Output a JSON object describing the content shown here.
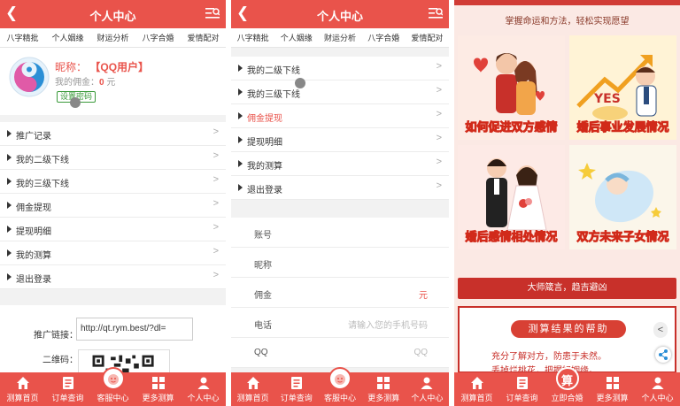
{
  "screen1": {
    "header": {
      "back_icon": "chevron-left-icon",
      "title": "个人中心",
      "menu_icon": "search-list-icon"
    },
    "tabs": [
      "八字精批",
      "个人姻缘",
      "财运分析",
      "八字合婚",
      "爱情配对"
    ],
    "profile": {
      "nickname_label": "昵称：",
      "nickname_value": "【QQ用户】",
      "commission_label": "我的佣金：",
      "commission_value": "0",
      "commission_unit": "元",
      "set_password": "设置密码"
    },
    "menu": [
      {
        "label": "推广记录"
      },
      {
        "label": "我的二级下线"
      },
      {
        "label": "我的三级下线"
      },
      {
        "label": "佣金提现"
      },
      {
        "label": "提现明细"
      },
      {
        "label": "我的测算"
      },
      {
        "label": "退出登录"
      }
    ],
    "arrow": ">",
    "promo": {
      "link_label": "推广链接：",
      "link_value": "http://qt.rym.best/?dl=",
      "qr_label": "二维码："
    }
  },
  "screen2": {
    "header": {
      "back_icon": "chevron-left-icon",
      "title": "个人中心",
      "menu_icon": "search-list-icon"
    },
    "tabs": [
      "八字精批",
      "个人姻缘",
      "财运分析",
      "八字合婚",
      "爱情配对"
    ],
    "menu": [
      {
        "label": "我的二级下线"
      },
      {
        "label": "我的三级下线"
      },
      {
        "label": "佣金提现"
      },
      {
        "label": "提现明细"
      },
      {
        "label": "我的测算"
      },
      {
        "label": "退出登录"
      }
    ],
    "form": [
      {
        "key": "账号",
        "value": ""
      },
      {
        "key": "昵称",
        "value": ""
      },
      {
        "key": "佣金",
        "value": "元"
      },
      {
        "key": "电话",
        "value": "请输入您的手机号码"
      },
      {
        "key": "QQ",
        "value": "QQ"
      }
    ]
  },
  "screen3": {
    "slogan": "掌握命运和方法，轻松实现愿望",
    "cards": [
      {
        "title": "如何促进双方感情"
      },
      {
        "title": "婚后事业发展情况"
      },
      {
        "title": "婚后感情相处情况"
      },
      {
        "title": "双方未来子女情况"
      }
    ],
    "yes_text": "YES",
    "banner": "大师箴言，趋吉避凶",
    "panel_title": "测算结果的帮助",
    "panel_lines": [
      "充分了解对方，防患于未然。",
      "丢掉烂桃花，把握好姻缘。"
    ],
    "side_chevron": "<"
  },
  "footer1": [
    {
      "label": "测算首页",
      "icon": "home-icon"
    },
    {
      "label": "订单查询",
      "icon": "order-list-icon"
    },
    {
      "label": "客服中心",
      "icon": "service-icon"
    },
    {
      "label": "更多测算",
      "icon": "grid-icon"
    },
    {
      "label": "个人中心",
      "icon": "user-icon"
    }
  ],
  "footer3": [
    {
      "label": "测算首页",
      "icon": "home-icon"
    },
    {
      "label": "订单查询",
      "icon": "order-list-icon"
    },
    {
      "label": "立即合婚",
      "icon": "suan-icon",
      "glyph": "算"
    },
    {
      "label": "更多测算",
      "icon": "grid-icon"
    },
    {
      "label": "个人中心",
      "icon": "user-icon"
    }
  ],
  "colors": {
    "primary": "#e9534b",
    "dark_red": "#c8302a",
    "background": "#f2f2f2"
  }
}
